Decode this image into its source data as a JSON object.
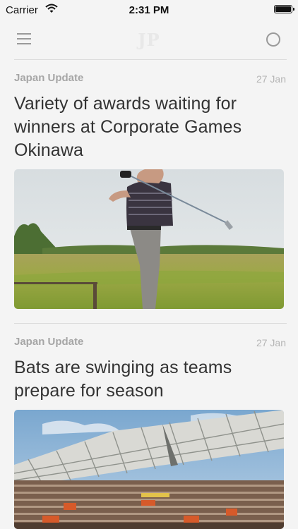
{
  "status_bar": {
    "carrier": "Carrier",
    "time": "2:31 PM",
    "icons": [
      "wifi-icon",
      "battery-icon"
    ]
  },
  "nav": {
    "logo": "JP",
    "menu_icon": "hamburger-menu-icon",
    "search_icon": "search-circle-icon"
  },
  "articles": [
    {
      "source": "Japan Update",
      "date": "27 Jan",
      "headline": "Variety of awards waiting for winners at Corporate Games Okinawa",
      "image": "golfer-swinging-photo"
    },
    {
      "source": "Japan Update",
      "date": "27 Jan",
      "headline": "Bats are swinging as teams prepare for season",
      "image": "baseball-stadium-crowd-photo"
    }
  ],
  "colors": {
    "background": "#f4f4f4",
    "headline": "#333333",
    "meta": "#a6a6a6"
  }
}
